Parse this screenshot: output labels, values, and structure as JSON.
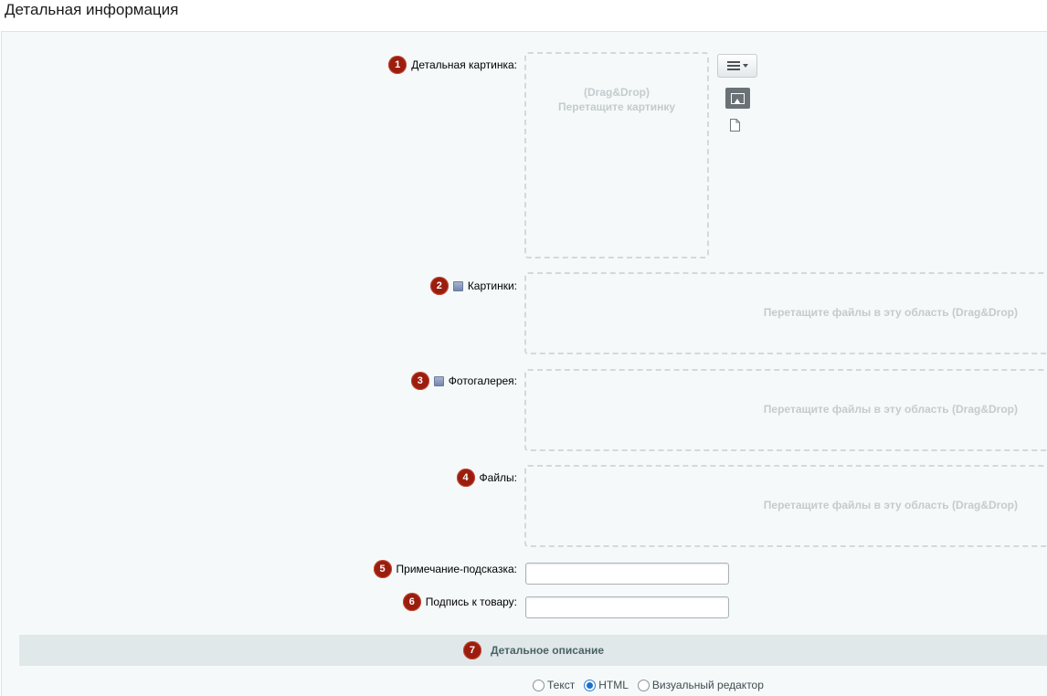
{
  "page_title": "Детальная информация",
  "detail_picture": {
    "badge": "1",
    "label": "Детальная картинка:",
    "dropzone_line1": "(Drag&Drop)",
    "dropzone_line2": "Перетащите картинку"
  },
  "rows": [
    {
      "badge": "2",
      "label": "Картинки:",
      "dropzone": "Перетащите файлы в эту область (Drag&Drop)"
    },
    {
      "badge": "3",
      "label": "Фотогалерея:",
      "dropzone": "Перетащите файлы в эту область (Drag&Drop)"
    },
    {
      "badge": "4",
      "label": "Файлы:",
      "dropzone": "Перетащите файлы в эту область (Drag&Drop)"
    }
  ],
  "fields": [
    {
      "badge": "5",
      "label": "Примечание-подсказка:",
      "value": ""
    },
    {
      "badge": "6",
      "label": "Подпись к товару:",
      "value": ""
    }
  ],
  "section": {
    "badge": "7",
    "title": "Детальное описание"
  },
  "editor_modes": [
    {
      "label": "Текст",
      "checked": false
    },
    {
      "label": "HTML",
      "checked": true
    },
    {
      "label": "Визуальный редактор",
      "checked": false
    }
  ],
  "colors": {
    "badge": "#9b1d0e",
    "section_bar": "#e0e8ea",
    "panel": "#f5f9f9"
  }
}
